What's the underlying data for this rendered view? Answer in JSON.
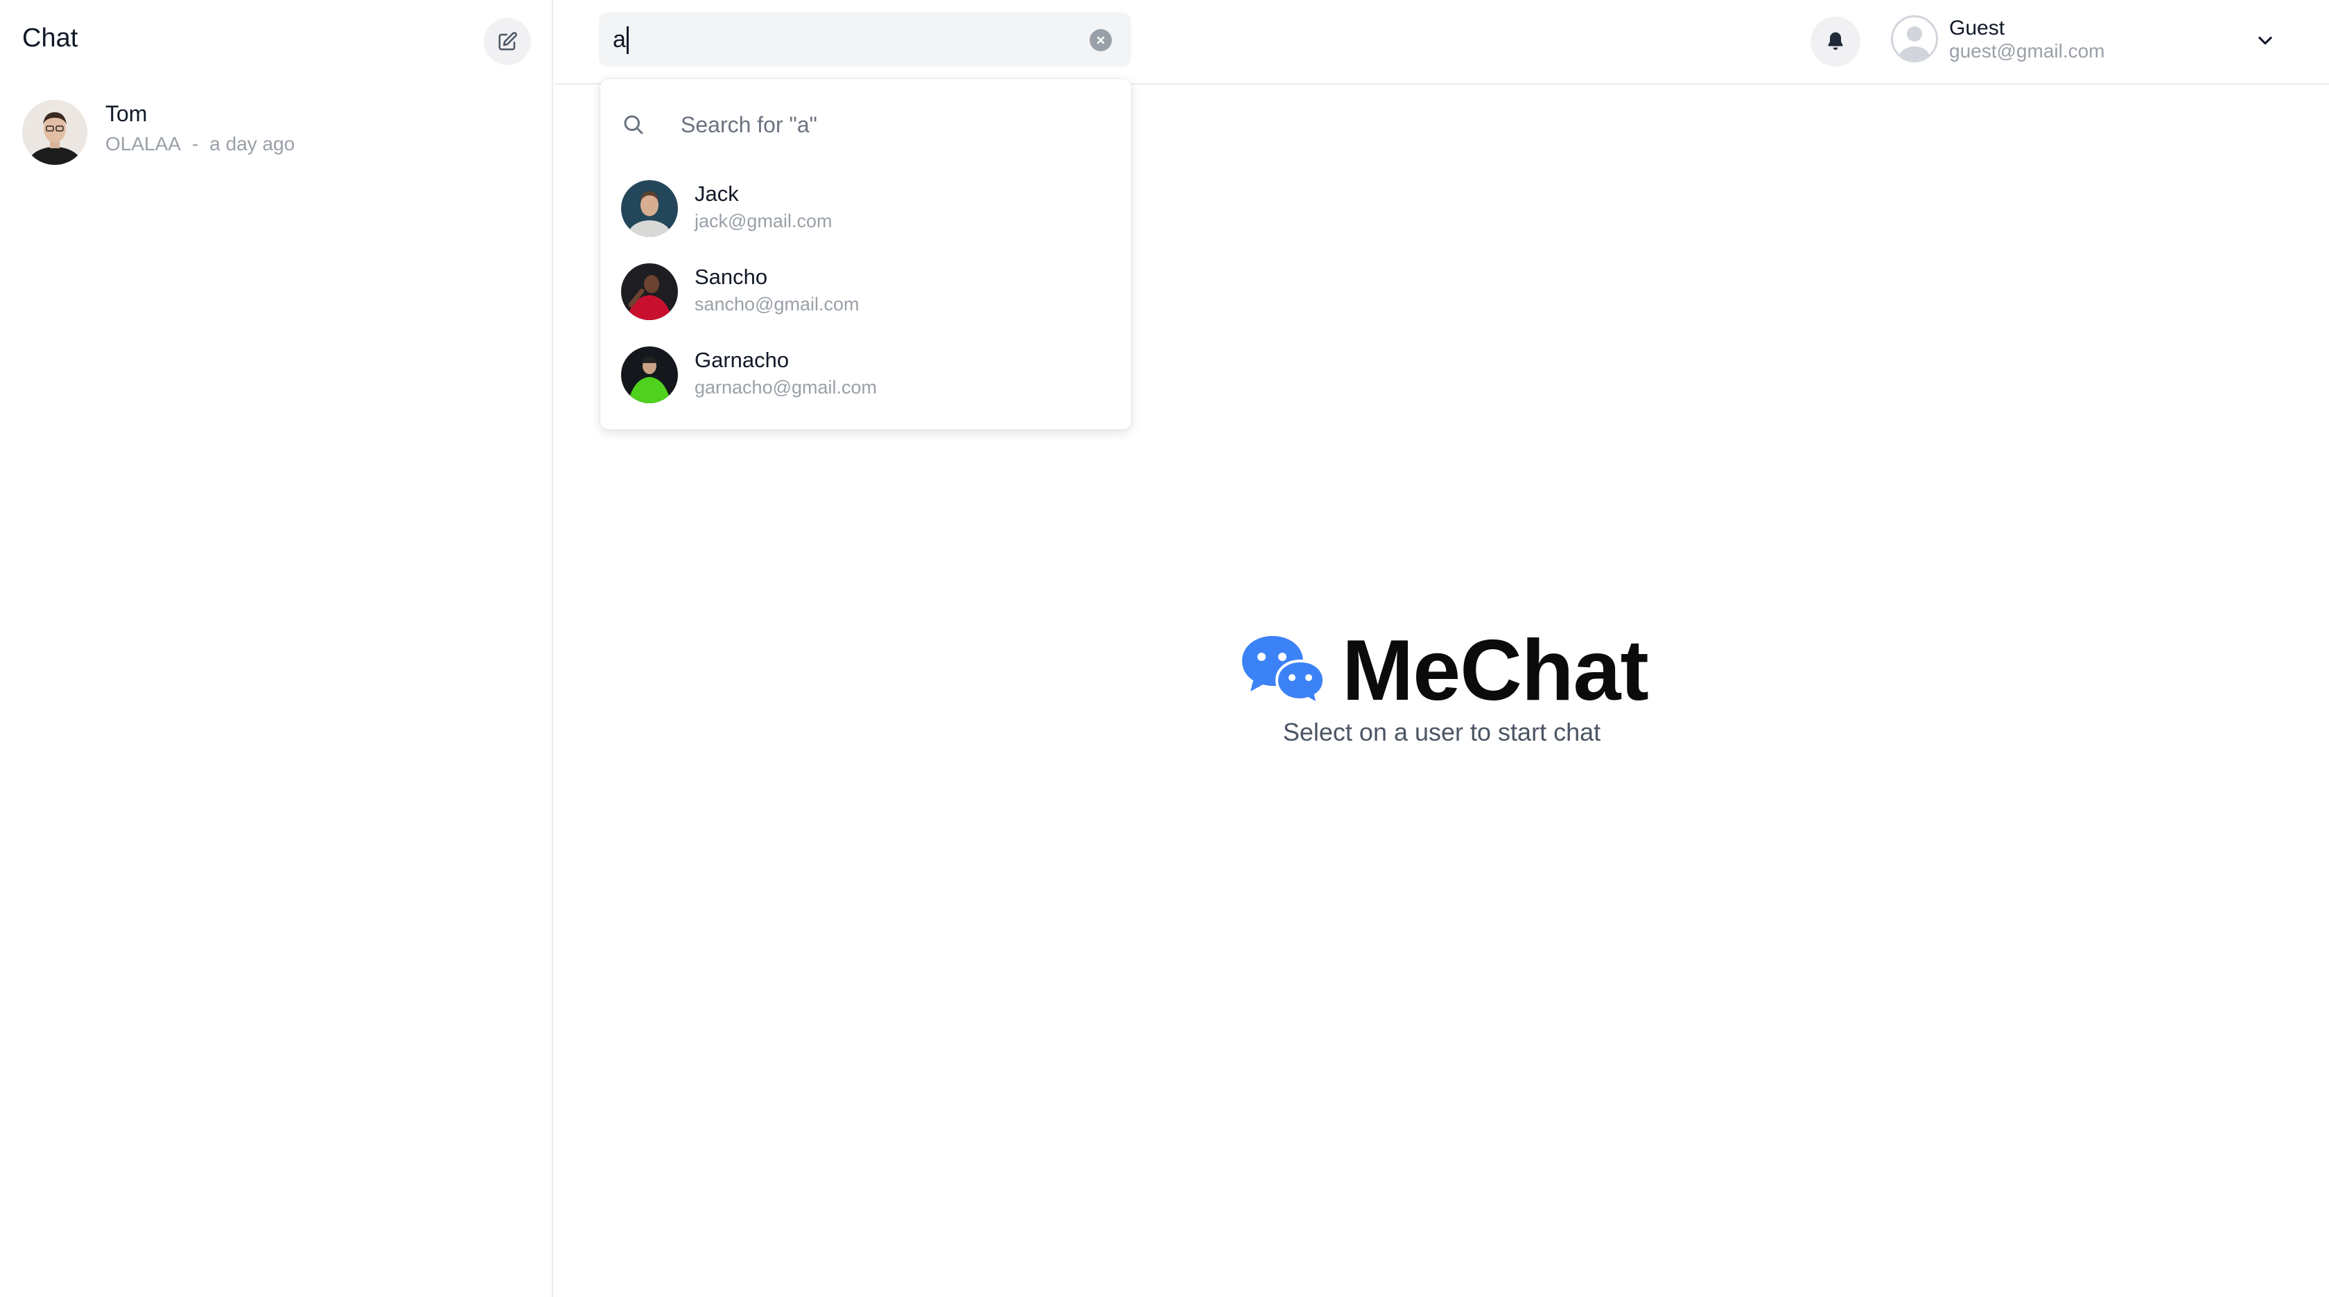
{
  "sidebar": {
    "title": "Chat",
    "conversations": [
      {
        "name": "Tom",
        "last_message": "OLALAA",
        "separator": "-",
        "time": "a day ago"
      }
    ]
  },
  "search": {
    "value": "a",
    "suggestion": "Search for \"a\"",
    "results": [
      {
        "name": "Jack",
        "email": "jack@gmail.com"
      },
      {
        "name": "Sancho",
        "email": "sancho@gmail.com"
      },
      {
        "name": "Garnacho",
        "email": "garnacho@gmail.com"
      }
    ]
  },
  "user": {
    "name": "Guest",
    "email": "guest@gmail.com"
  },
  "empty_state": {
    "brand": "MeChat",
    "subtitle": "Select on a user to start chat"
  },
  "colors": {
    "brand_blue": "#3b82f6",
    "muted_text": "#9aa0a8"
  },
  "icons": [
    "compose-icon",
    "search-icon",
    "clear-icon",
    "bell-icon",
    "user-icon",
    "chevron-down-icon",
    "chat-bubbles-icon"
  ]
}
